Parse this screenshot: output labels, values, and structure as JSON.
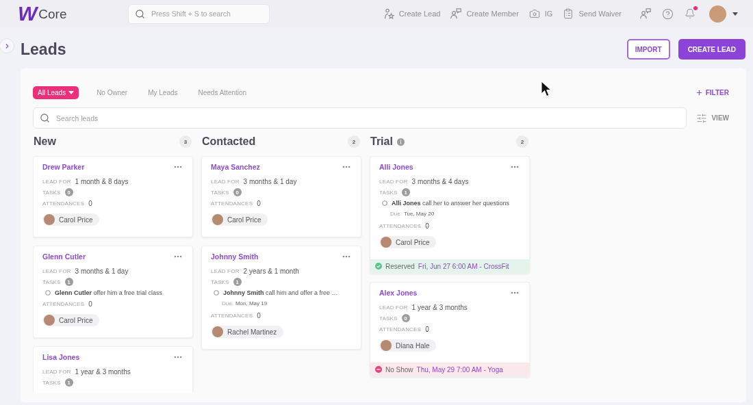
{
  "top_bar": {
    "logo": {
      "mark": "W",
      "name": "Core"
    },
    "search": {
      "placeholder": "Press Shift + S to search"
    },
    "actions": [
      {
        "label": "Create Lead"
      },
      {
        "label": "Create Member"
      },
      {
        "label": "IG"
      },
      {
        "label": "Send Waiver"
      }
    ],
    "notifications": {
      "unread": true
    }
  },
  "header": {
    "title": "Leads",
    "buttons": [
      {
        "kind": "outline",
        "label": "IMPORT"
      },
      {
        "kind": "primary",
        "label": "CREATE LEAD"
      }
    ]
  },
  "filter_tabs": [
    {
      "label": "All Leads",
      "selected": true
    },
    {
      "label": "No Owner",
      "selected": false
    },
    {
      "label": "My Leads",
      "selected": false
    },
    {
      "label": "Needs Attention",
      "selected": false
    }
  ],
  "filter_button": {
    "label": "FILTER"
  },
  "search": {
    "placeholder": "Search leads"
  },
  "view_button": {
    "label": "VIEW"
  },
  "columns": [
    {
      "title": "New",
      "count": "3",
      "info": false,
      "cards": [
        {
          "name": "Drew Parker",
          "lead_for_label": "LEAD FOR",
          "lead_for": "1 month & 8 days",
          "tasks_label": "TASKS",
          "task_count": "0",
          "attendances_label": "ATTENDANCES",
          "attendances": "0",
          "owner": "Carol Price"
        },
        {
          "name": "Glenn Cutler",
          "lead_for_label": "LEAD FOR",
          "lead_for": "3 months & 1 day",
          "tasks_label": "TASKS",
          "task_count": "1",
          "tasks": [
            {
              "text": "**Glenn Cutler** offer him a free trial class",
              "done": false
            }
          ],
          "attendances_label": "ATTENDANCES",
          "attendances": "0",
          "owner": "Carol Price"
        },
        {
          "name": "Lisa Jones",
          "lead_for_label": "LEAD FOR",
          "lead_for": "1 year & 3 months",
          "tasks_label": "TASKS",
          "task_count": "1"
        }
      ]
    },
    {
      "title": "Contacted",
      "count": "2",
      "info": false,
      "cards": [
        {
          "name": "Maya Sanchez",
          "lead_for_label": "LEAD FOR",
          "lead_for": "3 months & 1 day",
          "tasks_label": "TASKS",
          "task_count": "0",
          "attendances_label": "ATTENDANCES",
          "attendances": "0",
          "owner": "Carol Price"
        },
        {
          "name": "Johnny Smith",
          "lead_for_label": "LEAD FOR",
          "lead_for": "2 years & 1 month",
          "tasks_label": "TASKS",
          "task_count": "1",
          "tasks": [
            {
              "text": "**Johnny Smith** call him and offer a free …",
              "done": false,
              "due_label": "Due:",
              "due": "Mon, May 19"
            }
          ],
          "attendances_label": "ATTENDANCES",
          "attendances": "0",
          "owner": "Rachel Martinez"
        }
      ]
    },
    {
      "title": "Trial",
      "count": "2",
      "info": true,
      "cards": [
        {
          "name": "Alli Jones",
          "lead_for_label": "LEAD FOR",
          "lead_for": "3 months & 4 days",
          "tasks_label": "TASKS",
          "task_count": "1",
          "tasks": [
            {
              "text": "**Alli Jones** call her to answer her questions",
              "done": false,
              "due_label": "Due:",
              "due": "Tue, May 20"
            }
          ],
          "attendances_label": "ATTENDANCES",
          "attendances": "0",
          "owner": "Carol Price",
          "booking": {
            "kind": "reserved",
            "status": "Reserved",
            "detail": "Fri, Jun 27 6:00 AM - CrossFit"
          }
        },
        {
          "name": "Alex Jones",
          "lead_for_label": "LEAD FOR",
          "lead_for": "1 year & 3 months",
          "tasks_label": "TASKS",
          "task_count": "0",
          "attendances_label": "ATTENDANCES",
          "attendances": "0",
          "owner": "Diana Hale",
          "booking": {
            "kind": "no_show",
            "status": "No Show",
            "detail": "Thu, May 29 7:00 AM - Yoga"
          }
        }
      ]
    }
  ]
}
